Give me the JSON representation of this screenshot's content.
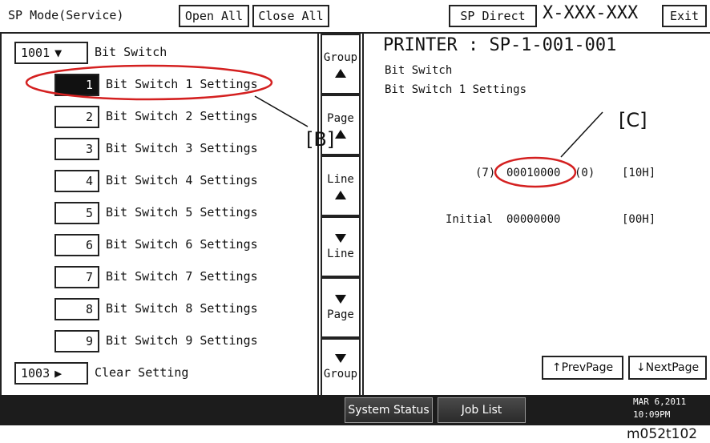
{
  "topbar": {
    "mode_title": "SP Mode(Service)",
    "open_all": "Open All",
    "close_all": "Close All",
    "sp_direct": "SP Direct",
    "sp_code": "X-XXX-XXX",
    "exit": "Exit"
  },
  "tree": {
    "group1": {
      "number": "1001",
      "arrow": "▼",
      "label": "Bit Switch"
    },
    "items": [
      {
        "num": "1",
        "label": "Bit Switch 1 Settings",
        "selected": true
      },
      {
        "num": "2",
        "label": "Bit Switch 2 Settings"
      },
      {
        "num": "3",
        "label": "Bit Switch 3 Settings"
      },
      {
        "num": "4",
        "label": "Bit Switch 4 Settings"
      },
      {
        "num": "5",
        "label": "Bit Switch 5 Settings"
      },
      {
        "num": "6",
        "label": "Bit Switch 6 Settings"
      },
      {
        "num": "7",
        "label": "Bit Switch 7 Settings"
      },
      {
        "num": "8",
        "label": "Bit Switch 8 Settings"
      },
      {
        "num": "9",
        "label": "Bit Switch 9 Settings"
      }
    ],
    "group2": {
      "number": "1003",
      "arrow": "▶",
      "label": "Clear Setting"
    }
  },
  "nav": {
    "group_up": "Group",
    "page_up": "Page",
    "line_up": "Line",
    "line_down": "Line",
    "page_down": "Page",
    "group_down": "Group"
  },
  "detail": {
    "heading": "PRINTER : SP-1-001-001",
    "sub1": "Bit Switch",
    "sub2": "Bit Switch 1 Settings",
    "bit_high": "(7)",
    "bits": "00010000",
    "bit_low": "(0)",
    "hex": "[10H]",
    "initial_label": "Initial",
    "initial_bits": "00000000",
    "initial_hex": "[00H]",
    "prev_page": "↑PrevPage",
    "next_page": "↓NextPage"
  },
  "callouts": {
    "b": "[B]",
    "c": "[C]",
    "color": "#d42020"
  },
  "statusbar": {
    "system_status": "System Status",
    "job_list": "Job List",
    "date": "MAR   6,2011",
    "time": "10:09PM"
  },
  "footer": {
    "figure_id": "m052t102"
  }
}
